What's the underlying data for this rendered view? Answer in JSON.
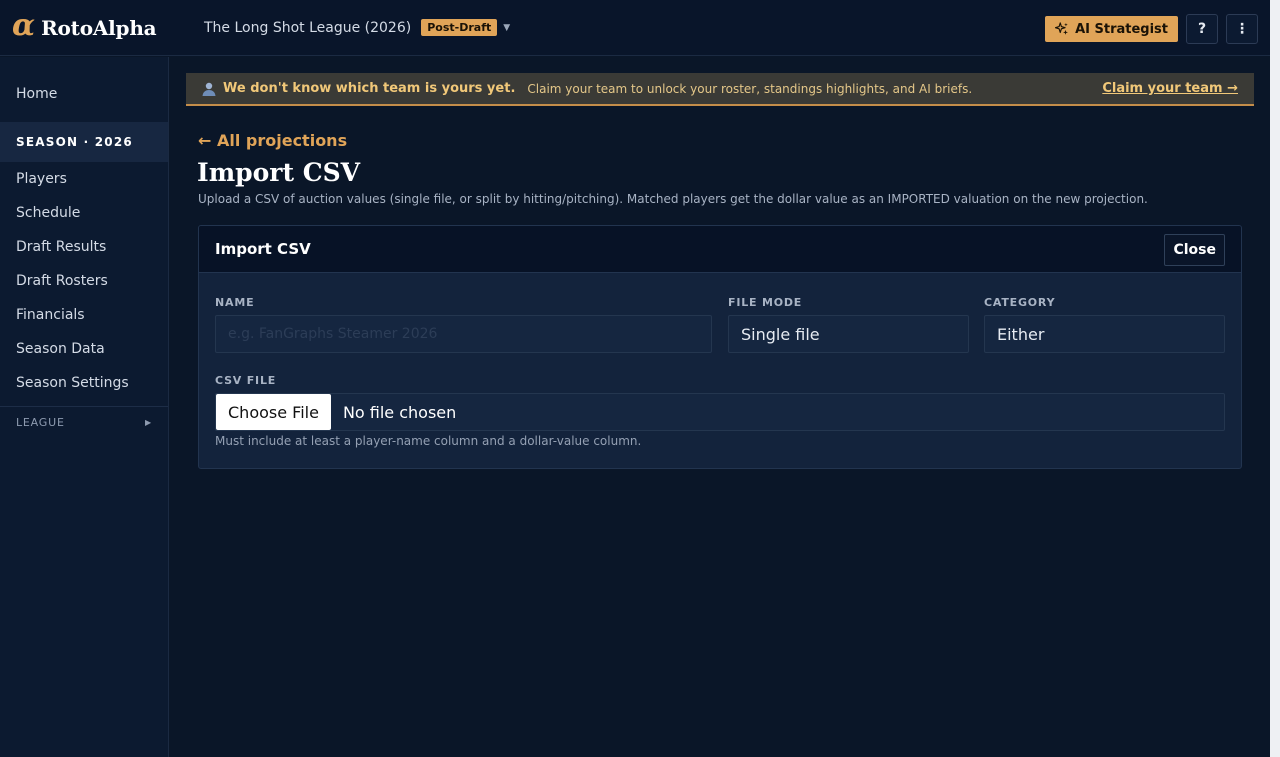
{
  "brand": {
    "logo_glyph": "α",
    "name": "RotoAlpha",
    "accent_color": "#e0a458"
  },
  "header": {
    "league_name": "The Long Shot League (2026)",
    "league_badge": "Post-Draft",
    "ai_button_label": "AI Strategist",
    "help_label": "?",
    "more_label": "⋮"
  },
  "sidebar": {
    "home": "Home",
    "section_label": "SEASON · 2026",
    "items": [
      "Players",
      "Schedule",
      "Draft Results",
      "Draft Rosters",
      "Financials",
      "Season Data",
      "Season Settings"
    ],
    "league_label": "LEAGUE"
  },
  "banner": {
    "strong": "We don't know which team is yours yet.",
    "text": "Claim your team to unlock your roster, standings highlights, and AI briefs.",
    "link": "Claim your team →"
  },
  "page": {
    "back_link": "← All projections",
    "title": "Import CSV",
    "subtitle": "Upload a CSV of auction values (single file, or split by hitting/pitching). Matched players get the dollar value as an IMPORTED valuation on the new projection."
  },
  "panel": {
    "title": "Import CSV",
    "close_label": "Close",
    "name_label": "NAME",
    "name_placeholder": "e.g. FanGraphs Steamer 2026",
    "name_value": "",
    "file_mode_label": "FILE MODE",
    "file_mode_value": "Single file",
    "category_label": "CATEGORY",
    "category_value": "Either",
    "csv_label": "CSV FILE",
    "choose_file_label": "Choose File",
    "no_file_text": "No file chosen",
    "hint": "Must include at least a player-name column and a dollar-value column."
  }
}
